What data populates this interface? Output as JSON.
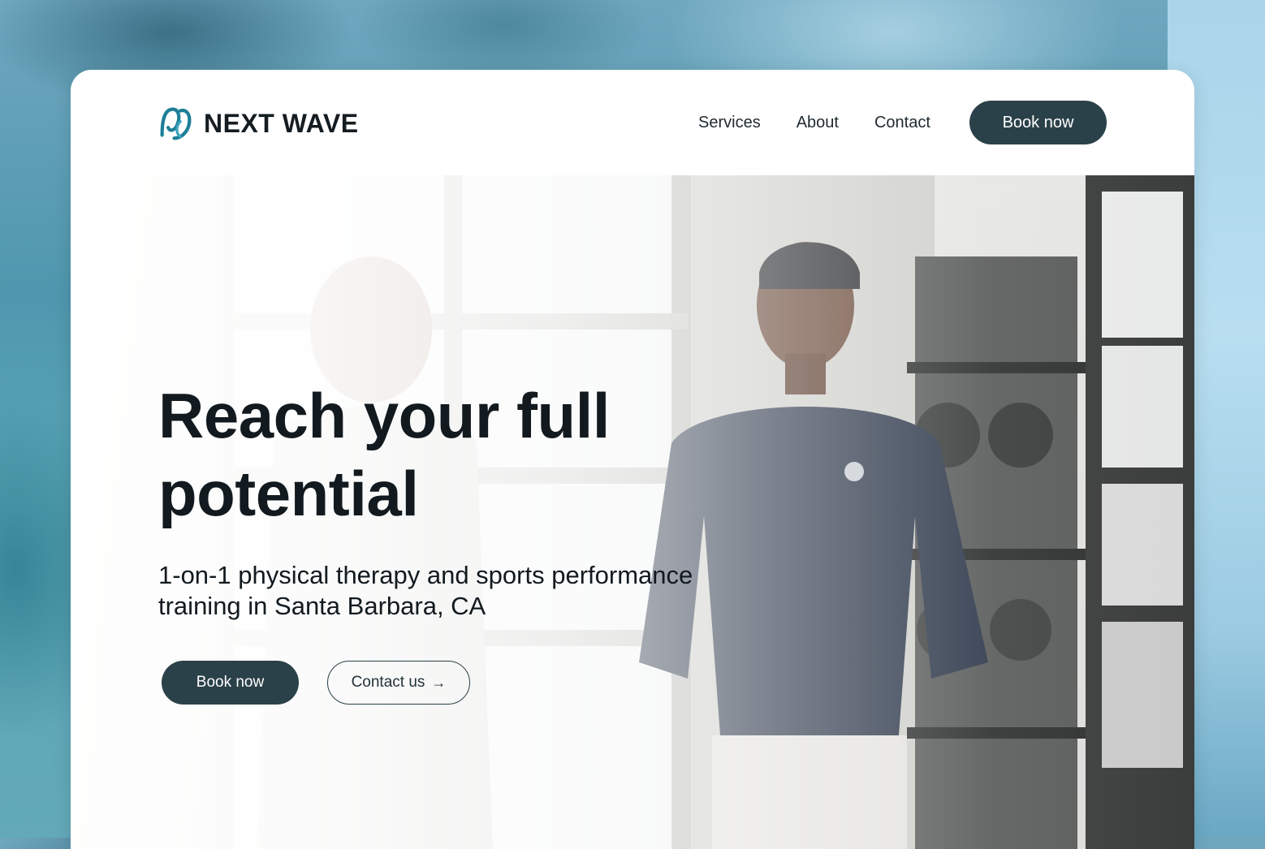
{
  "brand": {
    "name": "NEXT WAVE",
    "logo_icon": "wave-logo-icon",
    "accent_color": "#1e7f99"
  },
  "nav": {
    "links": [
      "Services",
      "About",
      "Contact"
    ],
    "cta_label": "Book now"
  },
  "hero": {
    "title": "Reach your full potential",
    "subtitle": "1-on-1 physical therapy and sports performance training in Santa Barbara, CA",
    "primary_label": "Book now",
    "secondary_label": "Contact us",
    "secondary_icon": "arrow-right-icon",
    "arrow_glyph": "→"
  },
  "colors": {
    "primary_button": "#2b4149",
    "text_dark": "#121a1f",
    "background_water": "#4f97ae"
  }
}
